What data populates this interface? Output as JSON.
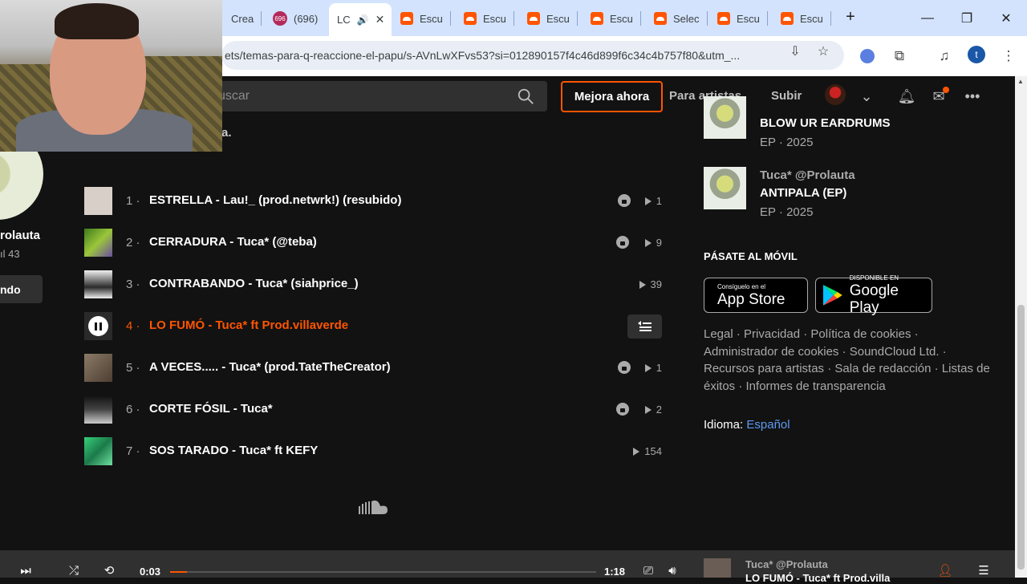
{
  "browser": {
    "tabs": [
      {
        "label": "Crea",
        "type": "partial"
      },
      {
        "label": "(696)",
        "type": "badge",
        "badge": "696"
      },
      {
        "label": "LC",
        "type": "active"
      },
      {
        "label": "Escu",
        "type": "sc"
      },
      {
        "label": "Escu",
        "type": "sc"
      },
      {
        "label": "Escu",
        "type": "sc"
      },
      {
        "label": "Escu",
        "type": "sc"
      },
      {
        "label": "Selec",
        "type": "sc"
      },
      {
        "label": "Escu",
        "type": "sc"
      },
      {
        "label": "Escu",
        "type": "sc"
      }
    ],
    "url": "ets/temas-para-q-reaccione-el-papu/s-AVnLwXFvs53?si=012890157f4c46d899f6c34c4b757f80&utm_...",
    "profile_initial": "t"
  },
  "header": {
    "search_placeholder": "uscar",
    "upgrade_label": "Mejora ahora",
    "for_artists_label": "Para artistas",
    "upload_label": "Subir"
  },
  "left_panel": {
    "description_fragment": "a.",
    "username": "rolauta",
    "follower_count": "43",
    "follow_button_label": "ndo"
  },
  "tracks": [
    {
      "number": "1",
      "title": "ESTRELLA - Lau!_ (prod.netwrk!) (resubido)",
      "plays": "1",
      "private": true,
      "playing": false,
      "thumb": "#d8d0c8"
    },
    {
      "number": "2",
      "title": "CERRADURA - Tuca* (@teba)",
      "plays": "9",
      "private": true,
      "playing": false,
      "thumb": "#4a8a2a"
    },
    {
      "number": "3",
      "title": "CONTRABANDO - Tuca* (siahprice_)",
      "plays": "39",
      "private": false,
      "playing": false,
      "thumb": "#e8e8e8"
    },
    {
      "number": "4",
      "title": "LO FUMÓ - Tuca* ft Prod.villaverde",
      "plays": "",
      "private": false,
      "playing": true,
      "thumb": "#222222"
    },
    {
      "number": "5",
      "title": "A VECES..... - Tuca* (prod.TateTheCreator)",
      "plays": "1",
      "private": true,
      "playing": false,
      "thumb": "#6b5a48"
    },
    {
      "number": "6",
      "title": "CORTE FÓSIL - Tuca*",
      "plays": "2",
      "private": true,
      "playing": false,
      "thumb": "#2b2b2b"
    },
    {
      "number": "7",
      "title": "SOS TARADO - Tuca* ft KEFY",
      "plays": "154",
      "private": false,
      "playing": false,
      "thumb": "#3bbf6a"
    }
  ],
  "sidebar": {
    "releases": [
      {
        "artist": "",
        "title": "BLOW UR EARDRUMS",
        "meta": "EP · 2025"
      },
      {
        "artist": "Tuca* @Prolauta",
        "title": "ANTIPALA (EP)",
        "meta": "EP · 2025"
      }
    ],
    "mobile_heading": "PÁSATE AL MÓVIL",
    "app_store": {
      "small": "Consíguelo en el",
      "big": "App Store"
    },
    "google_play": {
      "small": "DISPONIBLE EN",
      "big": "Google Play"
    },
    "footer_links": "Legal · Privacidad · Política de cookies · Administrador de cookies · SoundCloud Ltd. · Recursos para artistas · Sala de redacción · Listas de éxitos · Informes de transparencia",
    "language_label": "Idioma:",
    "language_value": "Español"
  },
  "player": {
    "current_time": "0:03",
    "duration": "1:18",
    "progress": 0.04,
    "now_playing_artist": "Tuca* @Prolauta",
    "now_playing_title": "LO FUMÓ - Tuca* ft Prod.villa"
  },
  "colors": {
    "accent": "#ff5500",
    "background": "#121212",
    "link": "#5d9af2"
  }
}
